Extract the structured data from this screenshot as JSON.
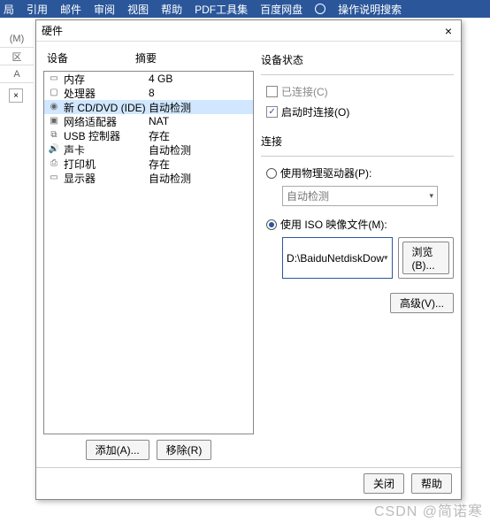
{
  "topbar": {
    "items": [
      "局",
      "引用",
      "邮件",
      "审阅",
      "视图",
      "帮助",
      "PDF工具集",
      "百度网盘"
    ],
    "search_hint": "操作说明搜索"
  },
  "leftstrip": {
    "label": "(M)",
    "extra": "区",
    "a": "A"
  },
  "dialog": {
    "title": "硬件",
    "close": "×",
    "headers": {
      "device": "设备",
      "summary": "摘要"
    },
    "rows": [
      {
        "icon": "▭",
        "device": "内存",
        "summary": "4 GB",
        "selected": false
      },
      {
        "icon": "▢",
        "device": "处理器",
        "summary": "8",
        "selected": false
      },
      {
        "icon": "◉",
        "device": "新 CD/DVD (IDE)",
        "summary": "自动检测",
        "selected": true
      },
      {
        "icon": "▣",
        "device": "网络适配器",
        "summary": "NAT",
        "selected": false
      },
      {
        "icon": "⧉",
        "device": "USB 控制器",
        "summary": "存在",
        "selected": false
      },
      {
        "icon": "🔊",
        "device": "声卡",
        "summary": "自动检测",
        "selected": false
      },
      {
        "icon": "⎙",
        "device": "打印机",
        "summary": "存在",
        "selected": false
      },
      {
        "icon": "▭",
        "device": "显示器",
        "summary": "自动检测",
        "selected": false
      }
    ],
    "buttons": {
      "add": "添加(A)...",
      "remove": "移除(R)"
    },
    "right": {
      "status_label": "设备状态",
      "connected": {
        "checked": false,
        "label": "已连接(C)"
      },
      "connect_on": {
        "checked": true,
        "label": "启动时连接(O)"
      },
      "connection_label": "连接",
      "use_physical": {
        "on": false,
        "label": "使用物理驱动器(P):"
      },
      "physical_value": "自动检测",
      "use_iso": {
        "on": true,
        "label": "使用 ISO 映像文件(M):"
      },
      "iso_value": "D:\\BaiduNetdiskDownload\\Cent",
      "browse": "浏览(B)...",
      "advanced": "高级(V)..."
    },
    "footer": {
      "close_btn": "关闭",
      "help_btn": "帮助"
    }
  },
  "watermark": "CSDN @简诺寒"
}
